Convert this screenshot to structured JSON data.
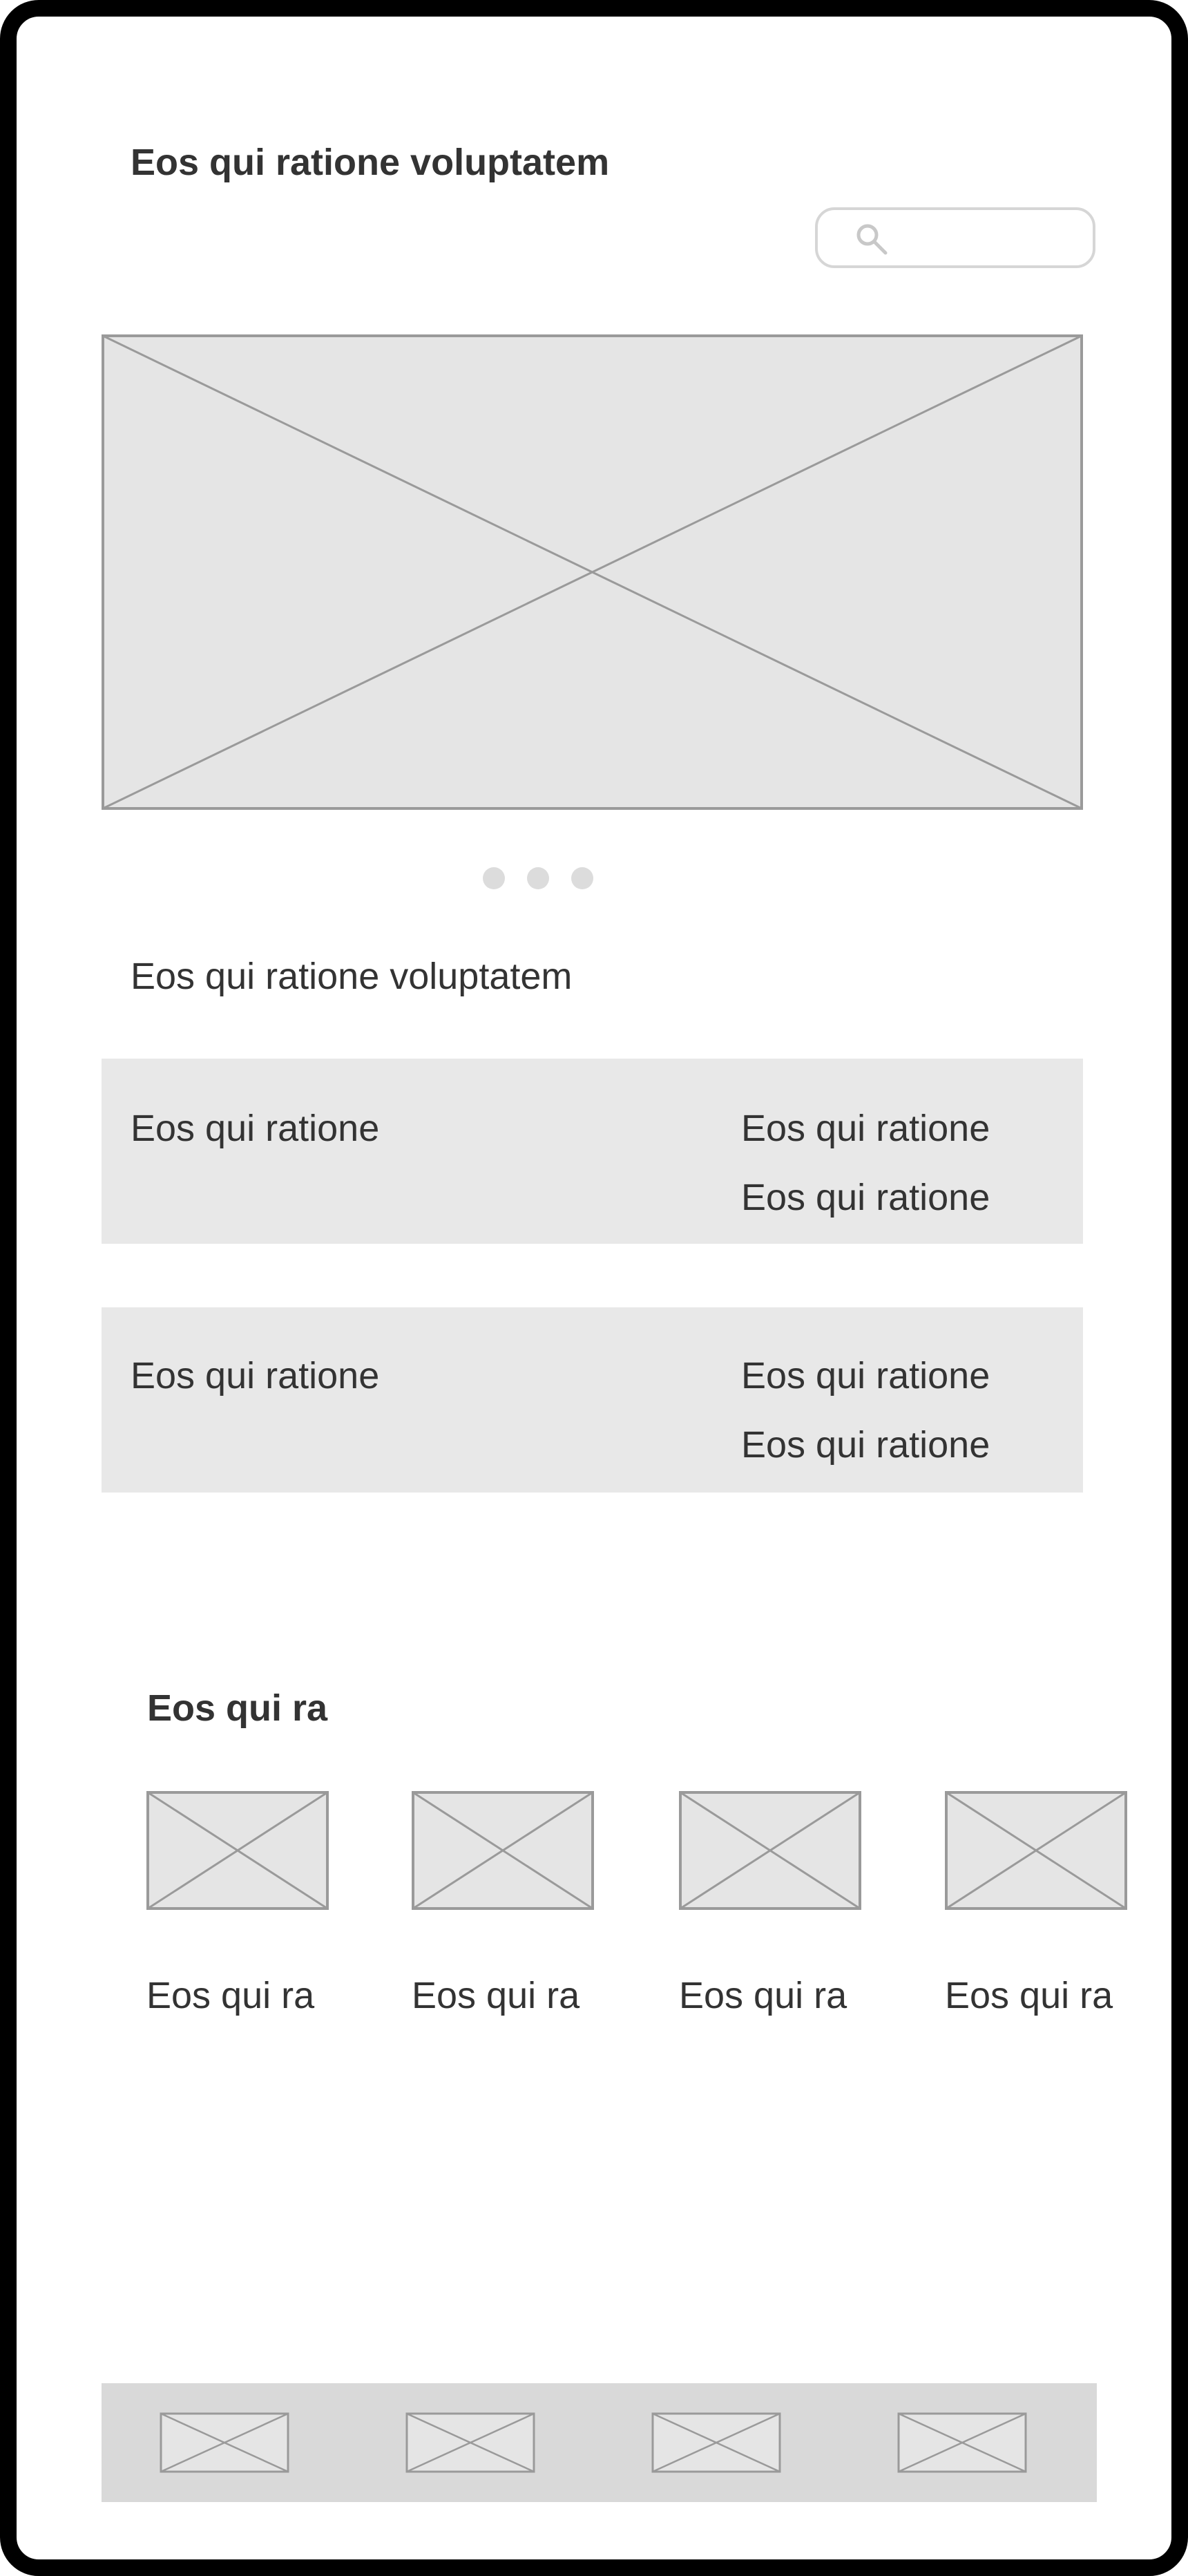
{
  "header": {
    "title": "Eos qui ratione voluptatem"
  },
  "search": {
    "icon": "search-icon",
    "placeholder": ""
  },
  "carousel": {
    "slide_count": 3,
    "active_index": 0
  },
  "section_heading": "Eos qui ratione voluptatem",
  "info_panels": [
    {
      "left": "Eos qui ratione",
      "right_line1": "Eos qui ratione",
      "right_line2": "Eos qui ratione"
    },
    {
      "left": "Eos qui ratione",
      "right_line1": "Eos qui ratione",
      "right_line2": "Eos qui ratione"
    }
  ],
  "gallery": {
    "title": "Eos qui ra",
    "items": [
      {
        "label": "Eos qui ra"
      },
      {
        "label": "Eos qui ra"
      },
      {
        "label": "Eos qui ra"
      },
      {
        "label": "Eos qui ra"
      }
    ]
  },
  "tab_bar": {
    "items": [
      "tab-1",
      "tab-2",
      "tab-3",
      "tab-4"
    ]
  },
  "colors": {
    "frame": "#000000",
    "placeholder_fill": "#e5e5e5",
    "placeholder_stroke": "#9a9a9a",
    "panel_bg": "#e8e8e8",
    "tabbar_bg": "#d9d9d9",
    "text": "#333333"
  }
}
